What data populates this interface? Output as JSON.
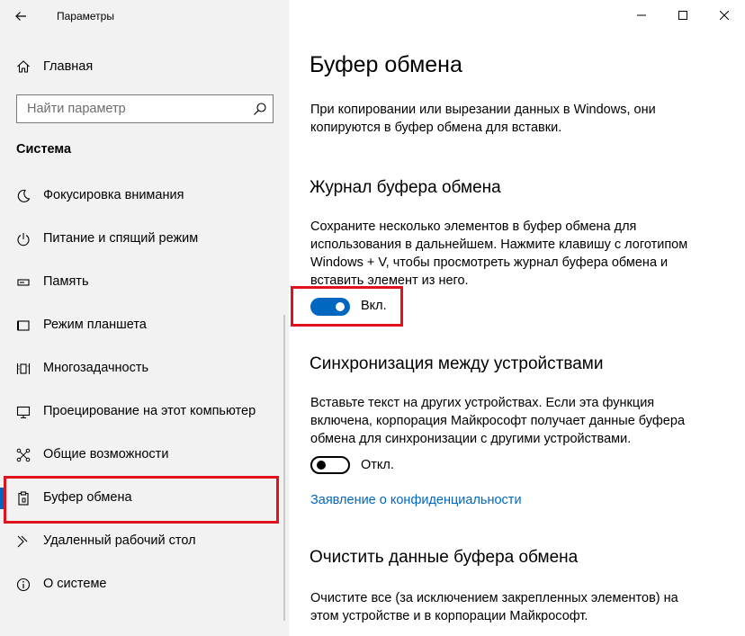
{
  "window": {
    "app_title": "Параметры",
    "controls": [
      "minimize",
      "maximize",
      "close"
    ]
  },
  "sidebar": {
    "home_label": "Главная",
    "search_placeholder": "Найти параметр",
    "section_title": "Система",
    "items": [
      {
        "label": "Фокусировка внимания",
        "icon": "moon-icon"
      },
      {
        "label": "Питание и спящий режим",
        "icon": "power-icon"
      },
      {
        "label": "Память",
        "icon": "storage-icon"
      },
      {
        "label": "Режим планшета",
        "icon": "tablet-icon"
      },
      {
        "label": "Многозадачность",
        "icon": "multitask-icon"
      },
      {
        "label": "Проецирование на этот компьютер",
        "icon": "projection-icon"
      },
      {
        "label": "Общие возможности",
        "icon": "shared-icon"
      },
      {
        "label": "Буфер обмена",
        "icon": "clipboard-icon",
        "selected": true
      },
      {
        "label": "Удаленный рабочий стол",
        "icon": "remote-desktop-icon"
      },
      {
        "label": "О системе",
        "icon": "info-icon"
      }
    ]
  },
  "main": {
    "title": "Буфер обмена",
    "intro": "При копировании или вырезании данных в Windows, они копируются в буфер обмена для вставки.",
    "history": {
      "heading": "Журнал буфера обмена",
      "description": "Сохраните несколько элементов в буфер обмена для использования в дальнейшем. Нажмите клавишу с логотипом Windows + V, чтобы просмотреть журнал буфера обмена и вставить элемент из него.",
      "toggle_state": "on",
      "toggle_label": "Вкл."
    },
    "sync": {
      "heading": "Синхронизация между устройствами",
      "description": "Вставьте текст на других устройствах. Если эта функция включена, корпорация Майкрософт получает данные буфера обмена для синхронизации с другими устройствами.",
      "toggle_state": "off",
      "toggle_label": "Откл.",
      "privacy_link": "Заявление о конфиденциальности"
    },
    "clear": {
      "heading": "Очистить данные буфера обмена",
      "description": "Очистите все (за исключением закрепленных элементов) на этом устройстве и в корпорации Майкрософт."
    }
  },
  "colors": {
    "accent": "#0067c0",
    "highlight_box": "#e0121b",
    "sidebar_bg": "#f2f2f2"
  }
}
